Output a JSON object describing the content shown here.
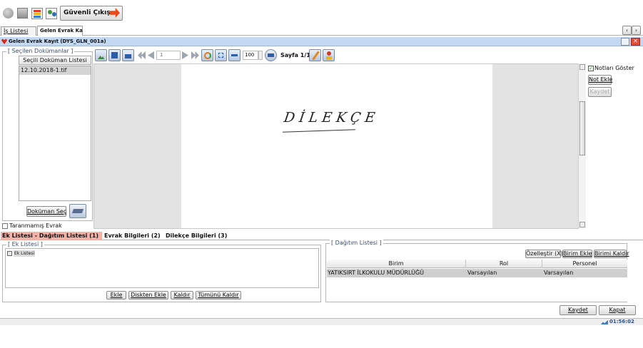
{
  "top_toolbar": {
    "logout_label": "Güvenli Çıkış"
  },
  "main_tabs": [
    {
      "label": "İş Listesi"
    },
    {
      "label": "Gelen Evrak Kayıt"
    }
  ],
  "window": {
    "title": "Gelen Evrak Kayıt (DYS_GLN_001a)"
  },
  "selected_docs": {
    "legend": "[ Seçilen Dokümanlar ]",
    "header": "Seçili Doküman Listesi",
    "items": [
      "12.10.2018-1.tif"
    ],
    "select_button": "Doküman Seç"
  },
  "viewer": {
    "page_input": "1",
    "zoom": "100",
    "page_indicator": "Sayfa 1/1",
    "document_text": "DİLEKÇE"
  },
  "notes_panel": {
    "show_notes_label": "Notları Göster",
    "add_note": "Not Ekle",
    "save": "Kaydet"
  },
  "unscanned_label": "Taranmamış Evrak",
  "lower_tabs": [
    {
      "label": "Ek Listesi - Dağıtım Listesi (1)"
    },
    {
      "label": "Evrak Bilgileri (2)"
    },
    {
      "label": "Dilekçe Bilgileri (3)"
    }
  ],
  "attachment_list": {
    "legend": "[ Ek Listesi ]",
    "tree_root": "Ek Listesi",
    "buttons": {
      "add": "Ekle",
      "add_from_disk": "Diskten Ekle",
      "remove": "Kaldır",
      "remove_all": "Tümünü Kaldır"
    }
  },
  "distribution_list": {
    "legend": "[ Dağıtım Listesi ]",
    "buttons": {
      "customize": "Özelleştir (X)",
      "add_unit": "Birim Ekle",
      "remove_unit": "Birimi Kaldır"
    },
    "columns": [
      "Birim",
      "Rol",
      "Personel"
    ],
    "rows": [
      {
        "birim": "YATIKSIRT İLKOKULU MÜDÜRLÜĞÜ",
        "rol": "Varsayılan",
        "personel": "Varsayılan"
      }
    ]
  },
  "footer": {
    "save": "Kaydet",
    "close": "Kapat",
    "clock": "01:56:02"
  },
  "colors": {
    "window_title_bg": "#c5d8f1",
    "active_tab_bg": "#f2b2a8",
    "selected_row_bg": "#cfcfcf",
    "viewer_gray": "#e3e3e3"
  }
}
